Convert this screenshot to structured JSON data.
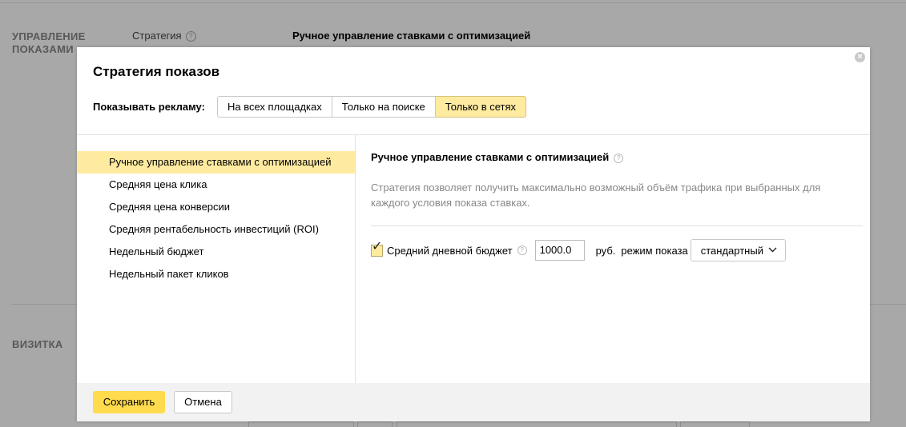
{
  "background": {
    "section_display_mgmt": "УПРАВЛЕНИЕ ПОКАЗАМИ",
    "strategy_label": "Стратегия",
    "strategy_help": "?",
    "strategy_value": "Ручное управление ставками с оптимизацией",
    "section_business_card": "ВИЗИТКА"
  },
  "modal": {
    "title": "Стратегия показов",
    "close_glyph": "×",
    "show_ads_label": "Показывать рекламу:",
    "placements": [
      {
        "label": "На всех площадках",
        "selected": false
      },
      {
        "label": "Только на поиске",
        "selected": false
      },
      {
        "label": "Только в сетях",
        "selected": true
      }
    ],
    "strategies": [
      {
        "label": "Ручное управление ставками с оптимизацией",
        "selected": true
      },
      {
        "label": "Средняя цена клика",
        "selected": false
      },
      {
        "label": "Средняя цена конверсии",
        "selected": false
      },
      {
        "label": "Средняя рентабельность инвестиций (ROI)",
        "selected": false
      },
      {
        "label": "Недельный бюджет",
        "selected": false
      },
      {
        "label": "Недельный пакет кликов",
        "selected": false
      }
    ],
    "detail": {
      "title": "Ручное управление ставками с оптимизацией",
      "help": "?",
      "description": "Стратегия позволяет получить максимально возможный объём трафика при выбранных для каждого условия показа ставках.",
      "daily_budget_label": "Средний дневной бюджет",
      "daily_budget_checked": true,
      "daily_budget_help": "?",
      "daily_budget_value": "1000.0",
      "currency": "руб.",
      "mode_label": "режим показа",
      "mode_value": "стандартный"
    },
    "footer": {
      "save_label": "Сохранить",
      "cancel_label": "Отмена"
    }
  },
  "colors": {
    "accent_yellow": "#ffdb4d",
    "selected_bg": "#ffeba0",
    "overlay": "#a8a8a8"
  },
  "icons": {
    "close": "close-icon",
    "help": "question-circle-icon",
    "checkbox": "checkmark-icon",
    "dropdown": "chevron-down-icon"
  }
}
